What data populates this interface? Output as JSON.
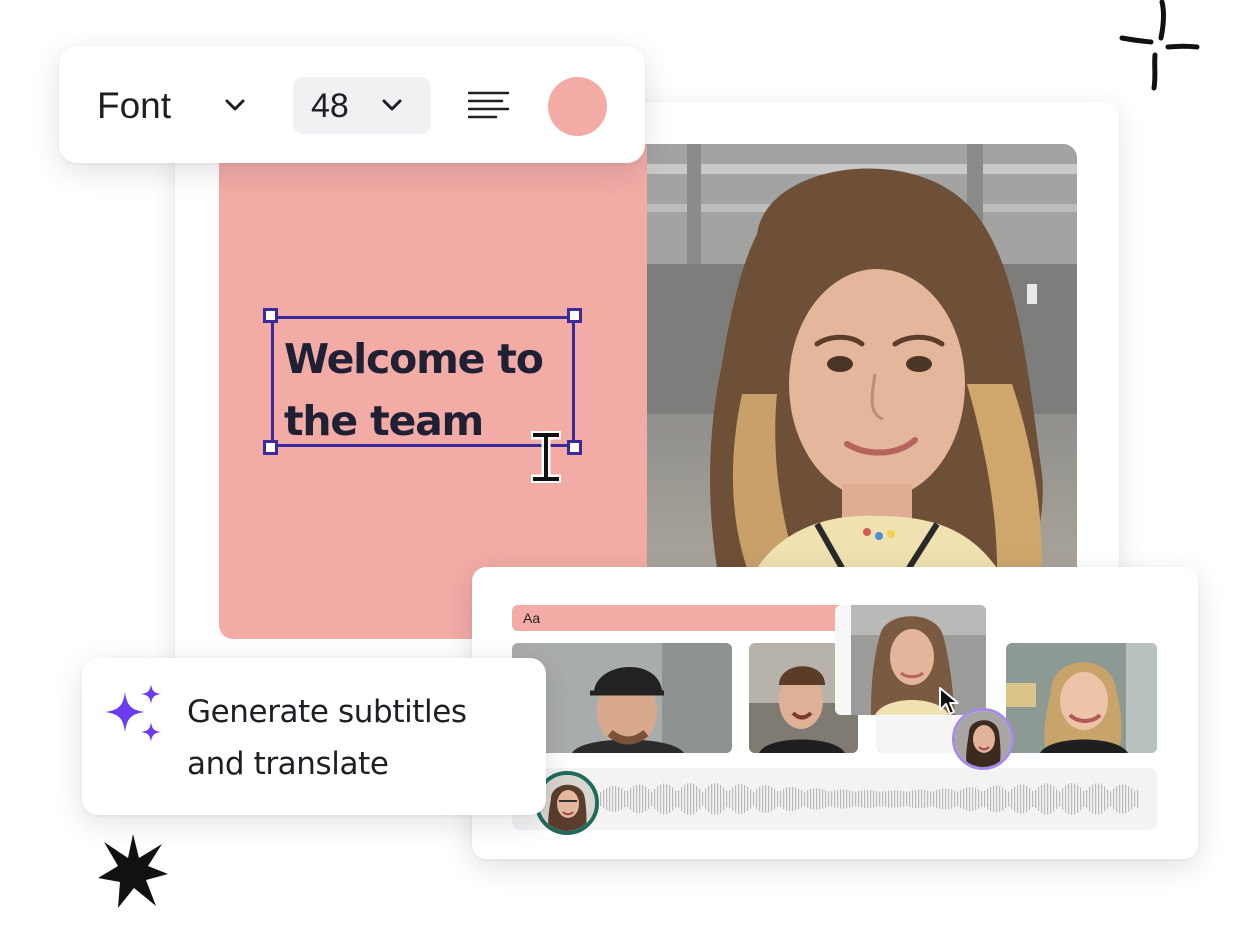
{
  "toolbar": {
    "font_label": "Font",
    "font_size": "48",
    "color_swatch": "#f2aba5",
    "icons": [
      "chevron-down-icon",
      "align-left-icon"
    ]
  },
  "slide": {
    "background": "#f2aba5",
    "heading_line1": "Welcome to",
    "heading_line2": "the team",
    "selection_color": "#3b2b9a"
  },
  "timeline": {
    "text_track_label": "Aa",
    "clips": [
      "clip-man-cap",
      "clip-man-smiling",
      "clip-woman-brunette",
      "clip-woman-blonde"
    ]
  },
  "ai_feature": {
    "line1": "Generate subtitles",
    "line2": "and translate",
    "icon": "sparkle-icon",
    "icon_color": "#6a3df0"
  },
  "decorations": [
    "four-point-star-icon",
    "asterisk-icon"
  ]
}
